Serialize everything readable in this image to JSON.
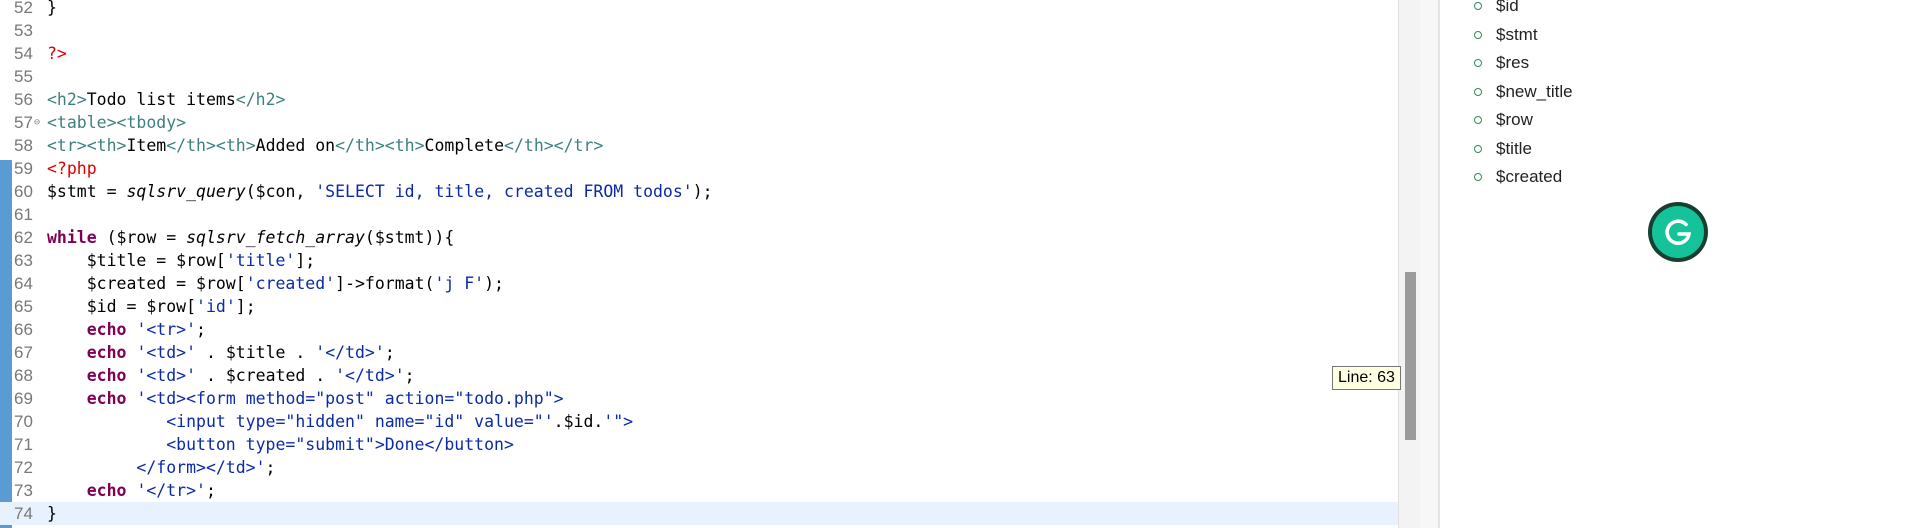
{
  "editor": {
    "lines": [
      {
        "n": "52",
        "tokens": [
          {
            "t": "}",
            "c": "t-txt"
          }
        ]
      },
      {
        "n": "53",
        "tokens": []
      },
      {
        "n": "54",
        "tokens": [
          {
            "t": "?>",
            "c": "t-php"
          }
        ]
      },
      {
        "n": "55",
        "tokens": []
      },
      {
        "n": "56",
        "tokens": [
          {
            "t": "<h2>",
            "c": "t-tag"
          },
          {
            "t": "Todo list items",
            "c": "t-txt"
          },
          {
            "t": "</h2>",
            "c": "t-tag"
          }
        ]
      },
      {
        "n": "57",
        "fold": "⊖",
        "tokens": [
          {
            "t": "<table><tbody>",
            "c": "t-tag"
          }
        ]
      },
      {
        "n": "58",
        "tokens": [
          {
            "t": "<tr><th>",
            "c": "t-tag"
          },
          {
            "t": "Item",
            "c": "t-txt"
          },
          {
            "t": "</th><th>",
            "c": "t-tag"
          },
          {
            "t": "Added on",
            "c": "t-txt"
          },
          {
            "t": "</th><th>",
            "c": "t-tag"
          },
          {
            "t": "Complete",
            "c": "t-txt"
          },
          {
            "t": "</th></tr>",
            "c": "t-tag"
          }
        ]
      },
      {
        "n": "59",
        "tokens": [
          {
            "t": "<?php",
            "c": "t-php"
          }
        ]
      },
      {
        "n": "60",
        "tokens": [
          {
            "t": "$stmt = ",
            "c": "t-txt"
          },
          {
            "t": "sqlsrv_query",
            "c": "t-fn"
          },
          {
            "t": "($con, ",
            "c": "t-txt"
          },
          {
            "t": "'SELECT id, title, created FROM todos'",
            "c": "t-str"
          },
          {
            "t": ");",
            "c": "t-txt"
          }
        ]
      },
      {
        "n": "61",
        "tokens": []
      },
      {
        "n": "62",
        "tokens": [
          {
            "t": "while",
            "c": "t-kw"
          },
          {
            "t": " ($row = ",
            "c": "t-txt"
          },
          {
            "t": "sqlsrv_fetch_array",
            "c": "t-fn"
          },
          {
            "t": "($stmt)){",
            "c": "t-txt"
          }
        ]
      },
      {
        "n": "63",
        "tokens": [
          {
            "t": "    $title = $row[",
            "c": "t-txt"
          },
          {
            "t": "'title'",
            "c": "t-str"
          },
          {
            "t": "];",
            "c": "t-txt"
          }
        ]
      },
      {
        "n": "64",
        "tokens": [
          {
            "t": "    $created = $row[",
            "c": "t-txt"
          },
          {
            "t": "'created'",
            "c": "t-str"
          },
          {
            "t": "]->format(",
            "c": "t-txt"
          },
          {
            "t": "'j F'",
            "c": "t-str"
          },
          {
            "t": ");",
            "c": "t-txt"
          }
        ]
      },
      {
        "n": "65",
        "tokens": [
          {
            "t": "    $id = $row[",
            "c": "t-txt"
          },
          {
            "t": "'id'",
            "c": "t-str"
          },
          {
            "t": "];",
            "c": "t-txt"
          }
        ]
      },
      {
        "n": "66",
        "tokens": [
          {
            "t": "    ",
            "c": "t-txt"
          },
          {
            "t": "echo",
            "c": "t-kw"
          },
          {
            "t": " ",
            "c": "t-txt"
          },
          {
            "t": "'<tr>'",
            "c": "t-str"
          },
          {
            "t": ";",
            "c": "t-txt"
          }
        ]
      },
      {
        "n": "67",
        "tokens": [
          {
            "t": "    ",
            "c": "t-txt"
          },
          {
            "t": "echo",
            "c": "t-kw"
          },
          {
            "t": " ",
            "c": "t-txt"
          },
          {
            "t": "'<td>'",
            "c": "t-str"
          },
          {
            "t": " . $title . ",
            "c": "t-txt"
          },
          {
            "t": "'</td>'",
            "c": "t-str"
          },
          {
            "t": ";",
            "c": "t-txt"
          }
        ]
      },
      {
        "n": "68",
        "tokens": [
          {
            "t": "    ",
            "c": "t-txt"
          },
          {
            "t": "echo",
            "c": "t-kw"
          },
          {
            "t": " ",
            "c": "t-txt"
          },
          {
            "t": "'<td>'",
            "c": "t-str"
          },
          {
            "t": " . $created . ",
            "c": "t-txt"
          },
          {
            "t": "'</td>'",
            "c": "t-str"
          },
          {
            "t": ";",
            "c": "t-txt"
          }
        ]
      },
      {
        "n": "69",
        "tokens": [
          {
            "t": "    ",
            "c": "t-txt"
          },
          {
            "t": "echo",
            "c": "t-kw"
          },
          {
            "t": " ",
            "c": "t-txt"
          },
          {
            "t": "'<td><form method=\"post\" action=\"todo.php\">",
            "c": "t-str"
          }
        ]
      },
      {
        "n": "70",
        "tokens": [
          {
            "t": "            <input type=\"hidden\" name=\"id\" value=\"'",
            "c": "t-str"
          },
          {
            "t": ".$id.",
            "c": "t-txt"
          },
          {
            "t": "'\">",
            "c": "t-str"
          }
        ]
      },
      {
        "n": "71",
        "tokens": [
          {
            "t": "            <button type=\"submit\">Done</button>",
            "c": "t-str"
          }
        ]
      },
      {
        "n": "72",
        "tokens": [
          {
            "t": "         </form></td>'",
            "c": "t-str"
          },
          {
            "t": ";",
            "c": "t-txt"
          }
        ]
      },
      {
        "n": "73",
        "tokens": [
          {
            "t": "    ",
            "c": "t-txt"
          },
          {
            "t": "echo",
            "c": "t-kw"
          },
          {
            "t": " ",
            "c": "t-txt"
          },
          {
            "t": "'</tr>'",
            "c": "t-str"
          },
          {
            "t": ";",
            "c": "t-txt"
          }
        ]
      },
      {
        "n": "74",
        "current": true,
        "tokens": [
          {
            "t": "}",
            "c": "t-txt"
          }
        ]
      }
    ]
  },
  "tooltip": {
    "text": "Line: 63"
  },
  "outline": {
    "items": [
      "$id",
      "$stmt",
      "$res",
      "$new_title",
      "$row",
      "$title",
      "$created"
    ]
  },
  "colors": {
    "tag": "#3f7f7f",
    "php_delim": "#e00000",
    "keyword": "#7f0055",
    "string": "#0a2aa8",
    "grammarly": "#15c39a"
  },
  "icons": {
    "fold": "collapse-minus-icon",
    "outline_bullet": "variable-circle-icon",
    "grammarly": "grammarly-g-icon"
  }
}
